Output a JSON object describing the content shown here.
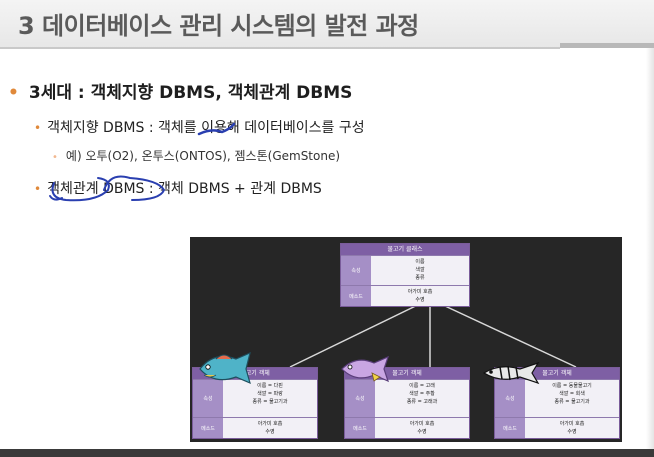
{
  "slide": {
    "title": "3 데이터베이스 관리 시스템의 발전 과정",
    "bullet1": "3세대 : 객체지향 DBMS, 객체관계 DBMS",
    "bullet2_prefix": "객체지향 DBMS : ",
    "bullet2_emph": "객체",
    "bullet2_suffix": "를 이용해 데이터베이스를 구성",
    "bullet3": "예) 오투(O2), 온투스(ONTOS), 젬스톤(GemStone)",
    "bullet4_emph1": "객체관계",
    "bullet4_emph2": "DBMS",
    "bullet4_suffix": " : 객체 DBMS + 관계 DBMS"
  },
  "diagram": {
    "top": {
      "header": "물고기 클래스",
      "attr_label": "속성",
      "attrs": [
        "이름",
        "색깔",
        "종류"
      ],
      "method_label": "메소드",
      "methods": [
        "아가미 호흡",
        "수영"
      ]
    },
    "children": [
      {
        "header": "물고기 객체",
        "attr_label": "속성",
        "attrs": [
          "이름 = 다핀",
          "색깔 = 파랑",
          "종류 = 물고기과"
        ],
        "method_label": "메소드",
        "methods": [
          "아가미 호흡",
          "수영"
        ]
      },
      {
        "header": "물고기 객체",
        "attr_label": "속성",
        "attrs": [
          "이름 = 고래",
          "색깔 = 주황",
          "종류 = 고래과"
        ],
        "method_label": "메소드",
        "methods": [
          "아가미 호흡",
          "수영"
        ]
      },
      {
        "header": "물고기 객체",
        "attr_label": "속성",
        "attrs": [
          "이름 = 동물물고기",
          "색깔 = 회색",
          "종류 = 물고기과"
        ],
        "method_label": "메소드",
        "methods": [
          "아가미 호흡",
          "수영"
        ]
      }
    ]
  },
  "colors": {
    "title_text": "#5a5a5a",
    "bullet_accent": "#e0893a",
    "ink": "#2a3fb0",
    "class_header": "#7e5fa4"
  }
}
